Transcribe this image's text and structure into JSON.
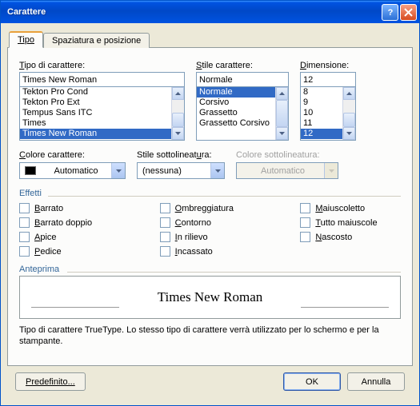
{
  "title": "Carattere",
  "tabs": {
    "type": "Tipo",
    "spacing": "Spaziatura e posizione"
  },
  "font": {
    "label": "Tipo di carattere:",
    "label_u": "T",
    "value": "Times New Roman",
    "items": [
      "Tekton Pro Cond",
      "Tekton Pro Ext",
      "Tempus Sans ITC",
      "Times",
      "Times New Roman"
    ],
    "selected": "Times New Roman"
  },
  "style": {
    "label": "Stile carattere:",
    "label_u": "S",
    "value": "Normale",
    "items": [
      "Normale",
      "Corsivo",
      "Grassetto",
      "Grassetto Corsivo"
    ],
    "selected": "Normale"
  },
  "size": {
    "label": "Dimensione:",
    "label_u": "D",
    "value": "12",
    "items": [
      "8",
      "9",
      "10",
      "11",
      "12"
    ],
    "selected": "12"
  },
  "color": {
    "label": "Colore carattere:",
    "label_u": "C",
    "value": "Automatico"
  },
  "underline": {
    "label": "Stile sottolineatura:",
    "label_u": "u",
    "value": "(nessuna)"
  },
  "ulcolor": {
    "label": "Colore sottolineatura:",
    "value": "Automatico",
    "disabled": true
  },
  "effects": {
    "label": "Effetti",
    "col1": [
      {
        "key": "strike",
        "label": "Barrato",
        "u": "B"
      },
      {
        "key": "dstrike",
        "label": "Barrato doppio",
        "u": "B"
      },
      {
        "key": "super",
        "label": "Apice",
        "u": "A"
      },
      {
        "key": "sub",
        "label": "Pedice",
        "u": "P"
      }
    ],
    "col2": [
      {
        "key": "shadow",
        "label": "Ombreggiatura",
        "u": "O"
      },
      {
        "key": "outline",
        "label": "Contorno",
        "u": "C"
      },
      {
        "key": "emboss",
        "label": "In rilievo",
        "u": "I"
      },
      {
        "key": "engrave",
        "label": "Incassato",
        "u": "I"
      }
    ],
    "col3": [
      {
        "key": "smallcaps",
        "label": "Maiuscoletto",
        "u": "M"
      },
      {
        "key": "allcaps",
        "label": "Tutto maiuscole",
        "u": "T"
      },
      {
        "key": "hidden",
        "label": "Nascosto",
        "u": "N"
      }
    ]
  },
  "preview": {
    "label": "Anteprima",
    "text": "Times New Roman"
  },
  "description": "Tipo di carattere TrueType. Lo stesso tipo di carattere verrà utilizzato per lo schermo e per la stampante.",
  "buttons": {
    "default": "Predefinito...",
    "ok": "OK",
    "cancel": "Annulla"
  }
}
